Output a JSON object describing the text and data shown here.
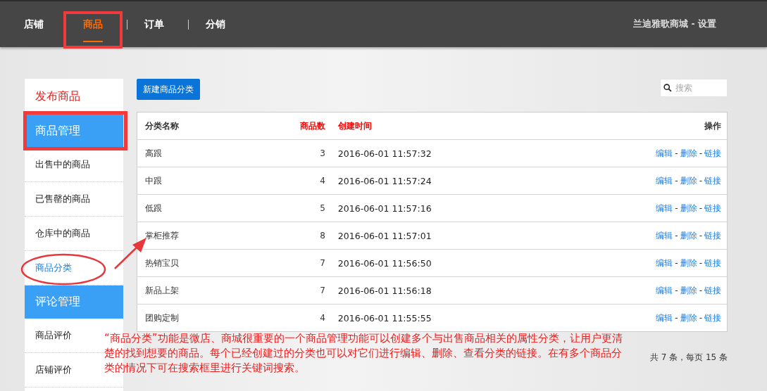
{
  "topbar": {
    "tabs": [
      {
        "label": "店铺",
        "selected": false,
        "highlighted": false
      },
      {
        "label": "商品",
        "selected": true,
        "highlighted": true
      },
      {
        "label": "订单",
        "selected": false,
        "highlighted": false
      },
      {
        "label": "分销",
        "selected": false,
        "highlighted": false
      }
    ],
    "account": "兰迪雅歌商城 - 设置"
  },
  "sidebar": {
    "items": [
      {
        "kind": "link",
        "label": "发布商品",
        "highlighted": false,
        "circled": false
      },
      {
        "kind": "header",
        "label": "商品管理",
        "highlighted": true,
        "circled": false
      },
      {
        "kind": "item",
        "label": "出售中的商品",
        "selected": false,
        "highlighted": false,
        "circled": false
      },
      {
        "kind": "item",
        "label": "已售罄的商品",
        "selected": false,
        "highlighted": false,
        "circled": false
      },
      {
        "kind": "item",
        "label": "仓库中的商品",
        "selected": false,
        "highlighted": false,
        "circled": false
      },
      {
        "kind": "item",
        "label": "商品分类",
        "selected": true,
        "highlighted": false,
        "circled": true
      },
      {
        "kind": "header",
        "label": "评论管理",
        "highlighted": false,
        "circled": false
      },
      {
        "kind": "item",
        "label": "商品评价",
        "selected": false,
        "highlighted": false,
        "circled": false
      },
      {
        "kind": "item",
        "label": "店铺评价",
        "selected": false,
        "highlighted": false,
        "circled": false
      }
    ]
  },
  "toolbar": {
    "new_button": "新建商品分类",
    "search": {
      "placeholder": "搜索"
    }
  },
  "table": {
    "columns": [
      {
        "label": "分类名称",
        "color": "#333333"
      },
      {
        "label": "商品数",
        "color": "#ff0000"
      },
      {
        "label": "创建时间",
        "color": "#ff0000"
      },
      {
        "label": "操作",
        "color": "#333333"
      }
    ],
    "rows": [
      {
        "name": "高跟",
        "count": "3",
        "created": "2016-06-01 11:57:32",
        "actions": [
          "编辑",
          "-",
          "删除",
          "-",
          "链接"
        ]
      },
      {
        "name": "中跟",
        "count": "4",
        "created": "2016-06-01 11:57:24",
        "actions": [
          "编辑",
          "-",
          "删除",
          "-",
          "链接"
        ]
      },
      {
        "name": "低跟",
        "count": "5",
        "created": "2016-06-01 11:57:16",
        "actions": [
          "编辑",
          "-",
          "删除",
          "-",
          "链接"
        ]
      },
      {
        "name": "掌柜推荐",
        "count": "8",
        "created": "2016-06-01 11:57:01",
        "actions": [
          "编辑",
          "-",
          "删除",
          "-",
          "链接"
        ]
      },
      {
        "name": "热销宝贝",
        "count": "7",
        "created": "2016-06-01 11:56:50",
        "actions": [
          "编辑",
          "-",
          "删除",
          "-",
          "链接"
        ]
      },
      {
        "name": "新品上架",
        "count": "7",
        "created": "2016-06-01 11:56:18",
        "actions": [
          "编辑",
          "-",
          "删除",
          "-",
          "链接"
        ]
      },
      {
        "name": "团购定制",
        "count": "4",
        "created": "2016-06-01 11:55:55",
        "actions": [
          "编辑",
          "-",
          "删除",
          "-",
          "链接"
        ]
      }
    ]
  },
  "pager": "共 7 条，每页 15 条",
  "annotation": {
    "note": "“商品分类”功能是微店、商城很重要的一个商品管理功能可以创建多个与出售商品相关的属性分类，让用户更清楚的找到想要的商品。每个已经创建过的分类也可以对它们进行编辑、删除、查看分类的链接。在有多个商品分类的情况下可在搜索框里进行关键词搜索。",
    "arrow": true
  }
}
